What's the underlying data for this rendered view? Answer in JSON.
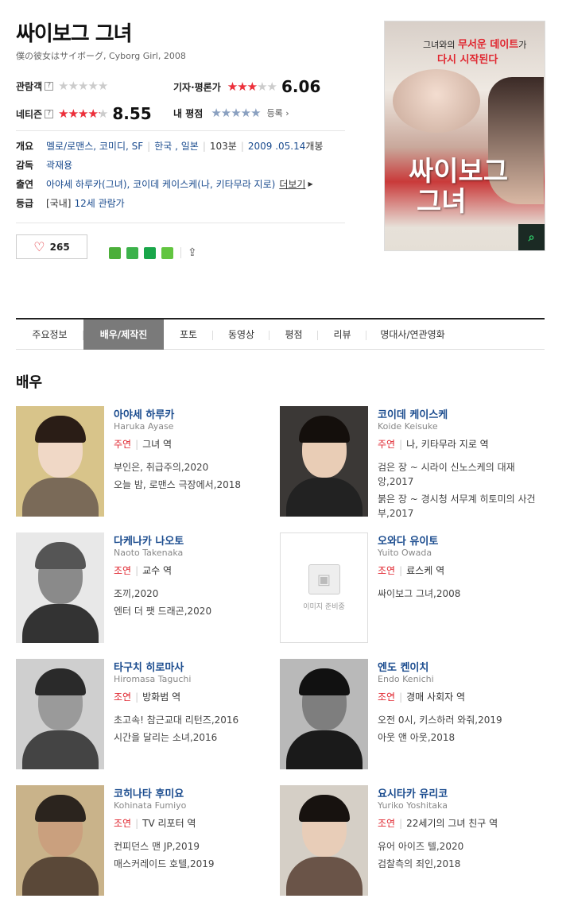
{
  "movie": {
    "title": "싸이보그 그녀",
    "subtitle": "僕の彼女はサイボーグ, Cyborg Girl, 2008"
  },
  "ratings": {
    "audience_label": "관람객",
    "audience_stars": 0,
    "critic_label": "기자·평론가",
    "critic_score": "6.06",
    "critic_stars": 0.606,
    "netizen_label": "네티즌",
    "netizen_score": "8.55",
    "netizen_stars": 0.855,
    "my_label": "내 평점",
    "register": "등록",
    "help_mark": "?"
  },
  "info": {
    "overview_label": "개요",
    "genres": "멜로/로맨스, 코미디, SF",
    "country": "한국 , 일본",
    "runtime": "103분",
    "release_date": "2009 .05.14",
    "release_suffix": "개봉",
    "director_label": "감독",
    "director": "곽재용",
    "cast_label": "출연",
    "cast": "아야세 하루카(그녀), 코이데 케이스케(나, 키타무라 지로)",
    "more": "더보기",
    "grade_label": "등급",
    "grade_prefix": "[국내]",
    "grade": "12세 관람가"
  },
  "like": {
    "count": "265"
  },
  "poster": {
    "tagline_pre": "그녀와의 ",
    "tagline_highlight": "무서운 데이트",
    "tagline_post": "가",
    "tagline2": "다시 시작된다",
    "title_line1": "싸이보그",
    "title_line2": "그녀"
  },
  "tabs": [
    "주요정보",
    "배우/제작진",
    "포토",
    "동영상",
    "평점",
    "리뷰",
    "명대사/연관영화"
  ],
  "section_title": "배우",
  "no_image_text": "이미지 준비중",
  "actors": [
    {
      "name": "아야세 하루카",
      "eng": "Haruka Ayase",
      "kind": "주연",
      "role": "그녀 역",
      "films": [
        "부인은, 취급주의,2020",
        "오늘 밤, 로맨스 극장에서,2018"
      ]
    },
    {
      "name": "코이데 케이스케",
      "eng": "Koide Keisuke",
      "kind": "주연",
      "role": "나, 키타무라 지로 역",
      "films": [
        "검은 장 ~ 시라이 신노스케의 대재앙,2017",
        "붉은 장 ~ 경시청 서무계 히토미의 사건부,2017"
      ]
    },
    {
      "name": "다케나카 나오토",
      "eng": "Naoto Takenaka",
      "kind": "조연",
      "role": "교수 역",
      "films": [
        "조끼,2020",
        "엔터 더 팻 드래곤,2020"
      ]
    },
    {
      "name": "오와다 유이토",
      "eng": "Yuito Owada",
      "kind": "조연",
      "role": "료스케 역",
      "films": [
        "싸이보그 그녀,2008"
      ]
    },
    {
      "name": "타구치 히로마사",
      "eng": "Hiromasa Taguchi",
      "kind": "조연",
      "role": "방화범 역",
      "films": [
        "초고속! 참근교대 리턴즈,2016",
        "시간을 달리는 소녀,2016"
      ]
    },
    {
      "name": "엔도 켄이치",
      "eng": "Endo Kenichi",
      "kind": "조연",
      "role": "경매 사회자 역",
      "films": [
        "오전 0시, 키스하러 와줘,2019",
        "아웃 앤 아웃,2018"
      ]
    },
    {
      "name": "코히나타 후미요",
      "eng": "Kohinata Fumiyo",
      "kind": "조연",
      "role": "TV 리포터 역",
      "films": [
        "컨피던스 맨 JP,2019",
        "매스커레이드 호텔,2019"
      ]
    },
    {
      "name": "요시타카 유리코",
      "eng": "Yuriko Yoshitaka",
      "kind": "조연",
      "role": "22세기의 그녀 친구 역",
      "films": [
        "유어 아이즈 텔,2020",
        "검찰측의 죄인,2018"
      ]
    }
  ]
}
